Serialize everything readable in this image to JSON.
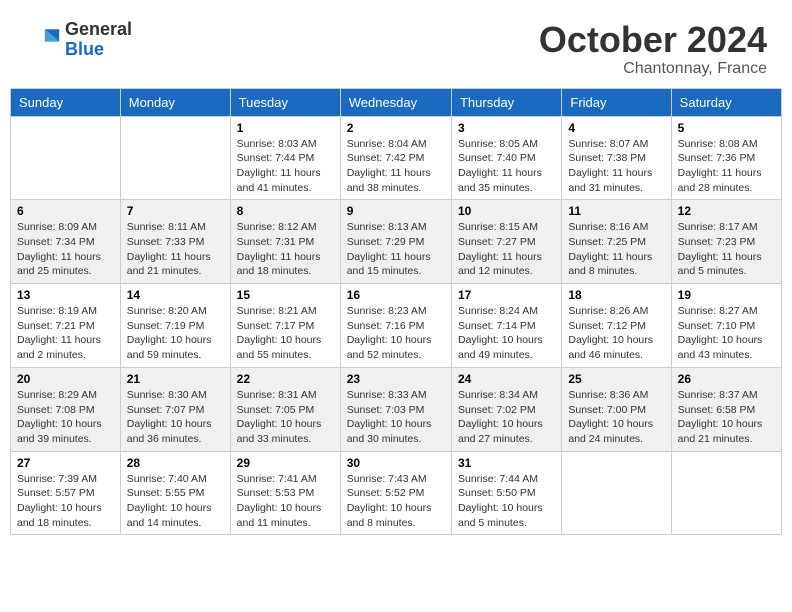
{
  "logo": {
    "general": "General",
    "blue": "Blue"
  },
  "title": "October 2024",
  "subtitle": "Chantonnay, France",
  "days_of_week": [
    "Sunday",
    "Monday",
    "Tuesday",
    "Wednesday",
    "Thursday",
    "Friday",
    "Saturday"
  ],
  "weeks": [
    [
      {
        "day": "",
        "info": ""
      },
      {
        "day": "",
        "info": ""
      },
      {
        "day": "1",
        "info": "Sunrise: 8:03 AM\nSunset: 7:44 PM\nDaylight: 11 hours and 41 minutes."
      },
      {
        "day": "2",
        "info": "Sunrise: 8:04 AM\nSunset: 7:42 PM\nDaylight: 11 hours and 38 minutes."
      },
      {
        "day": "3",
        "info": "Sunrise: 8:05 AM\nSunset: 7:40 PM\nDaylight: 11 hours and 35 minutes."
      },
      {
        "day": "4",
        "info": "Sunrise: 8:07 AM\nSunset: 7:38 PM\nDaylight: 11 hours and 31 minutes."
      },
      {
        "day": "5",
        "info": "Sunrise: 8:08 AM\nSunset: 7:36 PM\nDaylight: 11 hours and 28 minutes."
      }
    ],
    [
      {
        "day": "6",
        "info": "Sunrise: 8:09 AM\nSunset: 7:34 PM\nDaylight: 11 hours and 25 minutes."
      },
      {
        "day": "7",
        "info": "Sunrise: 8:11 AM\nSunset: 7:33 PM\nDaylight: 11 hours and 21 minutes."
      },
      {
        "day": "8",
        "info": "Sunrise: 8:12 AM\nSunset: 7:31 PM\nDaylight: 11 hours and 18 minutes."
      },
      {
        "day": "9",
        "info": "Sunrise: 8:13 AM\nSunset: 7:29 PM\nDaylight: 11 hours and 15 minutes."
      },
      {
        "day": "10",
        "info": "Sunrise: 8:15 AM\nSunset: 7:27 PM\nDaylight: 11 hours and 12 minutes."
      },
      {
        "day": "11",
        "info": "Sunrise: 8:16 AM\nSunset: 7:25 PM\nDaylight: 11 hours and 8 minutes."
      },
      {
        "day": "12",
        "info": "Sunrise: 8:17 AM\nSunset: 7:23 PM\nDaylight: 11 hours and 5 minutes."
      }
    ],
    [
      {
        "day": "13",
        "info": "Sunrise: 8:19 AM\nSunset: 7:21 PM\nDaylight: 11 hours and 2 minutes."
      },
      {
        "day": "14",
        "info": "Sunrise: 8:20 AM\nSunset: 7:19 PM\nDaylight: 10 hours and 59 minutes."
      },
      {
        "day": "15",
        "info": "Sunrise: 8:21 AM\nSunset: 7:17 PM\nDaylight: 10 hours and 55 minutes."
      },
      {
        "day": "16",
        "info": "Sunrise: 8:23 AM\nSunset: 7:16 PM\nDaylight: 10 hours and 52 minutes."
      },
      {
        "day": "17",
        "info": "Sunrise: 8:24 AM\nSunset: 7:14 PM\nDaylight: 10 hours and 49 minutes."
      },
      {
        "day": "18",
        "info": "Sunrise: 8:26 AM\nSunset: 7:12 PM\nDaylight: 10 hours and 46 minutes."
      },
      {
        "day": "19",
        "info": "Sunrise: 8:27 AM\nSunset: 7:10 PM\nDaylight: 10 hours and 43 minutes."
      }
    ],
    [
      {
        "day": "20",
        "info": "Sunrise: 8:29 AM\nSunset: 7:08 PM\nDaylight: 10 hours and 39 minutes."
      },
      {
        "day": "21",
        "info": "Sunrise: 8:30 AM\nSunset: 7:07 PM\nDaylight: 10 hours and 36 minutes."
      },
      {
        "day": "22",
        "info": "Sunrise: 8:31 AM\nSunset: 7:05 PM\nDaylight: 10 hours and 33 minutes."
      },
      {
        "day": "23",
        "info": "Sunrise: 8:33 AM\nSunset: 7:03 PM\nDaylight: 10 hours and 30 minutes."
      },
      {
        "day": "24",
        "info": "Sunrise: 8:34 AM\nSunset: 7:02 PM\nDaylight: 10 hours and 27 minutes."
      },
      {
        "day": "25",
        "info": "Sunrise: 8:36 AM\nSunset: 7:00 PM\nDaylight: 10 hours and 24 minutes."
      },
      {
        "day": "26",
        "info": "Sunrise: 8:37 AM\nSunset: 6:58 PM\nDaylight: 10 hours and 21 minutes."
      }
    ],
    [
      {
        "day": "27",
        "info": "Sunrise: 7:39 AM\nSunset: 5:57 PM\nDaylight: 10 hours and 18 minutes."
      },
      {
        "day": "28",
        "info": "Sunrise: 7:40 AM\nSunset: 5:55 PM\nDaylight: 10 hours and 14 minutes."
      },
      {
        "day": "29",
        "info": "Sunrise: 7:41 AM\nSunset: 5:53 PM\nDaylight: 10 hours and 11 minutes."
      },
      {
        "day": "30",
        "info": "Sunrise: 7:43 AM\nSunset: 5:52 PM\nDaylight: 10 hours and 8 minutes."
      },
      {
        "day": "31",
        "info": "Sunrise: 7:44 AM\nSunset: 5:50 PM\nDaylight: 10 hours and 5 minutes."
      },
      {
        "day": "",
        "info": ""
      },
      {
        "day": "",
        "info": ""
      }
    ]
  ]
}
